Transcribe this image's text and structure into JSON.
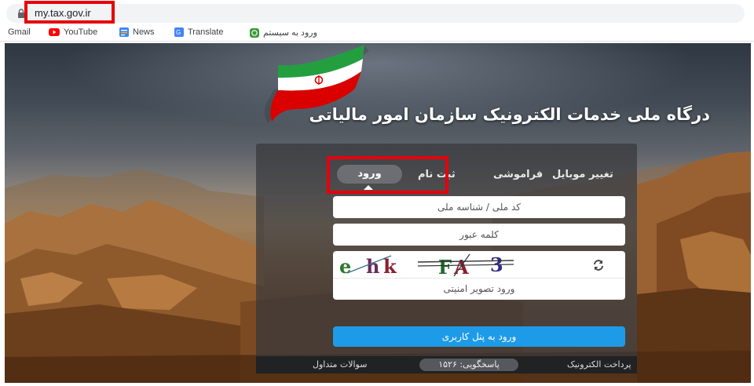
{
  "browser": {
    "url": "my.tax.gov.ir",
    "bookmarks": [
      {
        "label": "Gmail",
        "icon": "gmail-icon"
      },
      {
        "label": "YouTube",
        "icon": "youtube-icon"
      },
      {
        "label": "News",
        "icon": "news-icon"
      },
      {
        "label": "Translate",
        "icon": "translate-icon"
      },
      {
        "label": "ورود به سیستم",
        "icon": "login-system-icon"
      }
    ],
    "accent_highlight": "#e6000b"
  },
  "page": {
    "title": "درگاه ملی خدمات الکترونیک سازمان امور مالیاتی",
    "tabs": {
      "login": "ورود",
      "register": "ثبت نام",
      "forgot": "فراموشی",
      "change_mobile": "تغییر موبایل"
    },
    "fields": {
      "national_id_placeholder": "کد ملی / شناسه ملی",
      "password_placeholder": "کلمه عبور",
      "captcha_placeholder": "ورود تصویر امنیتی"
    },
    "captcha_text": "e hk FA 3",
    "submit_label": "ورود به پنل کاربری",
    "footer": {
      "e_payment": "پرداخت الکترونیک",
      "support": "پاسخگویی: ۱۵۲۶",
      "faq": "سوالات متداول"
    },
    "colors": {
      "submit_button": "#1e9be8",
      "panel": "#36383c"
    }
  }
}
